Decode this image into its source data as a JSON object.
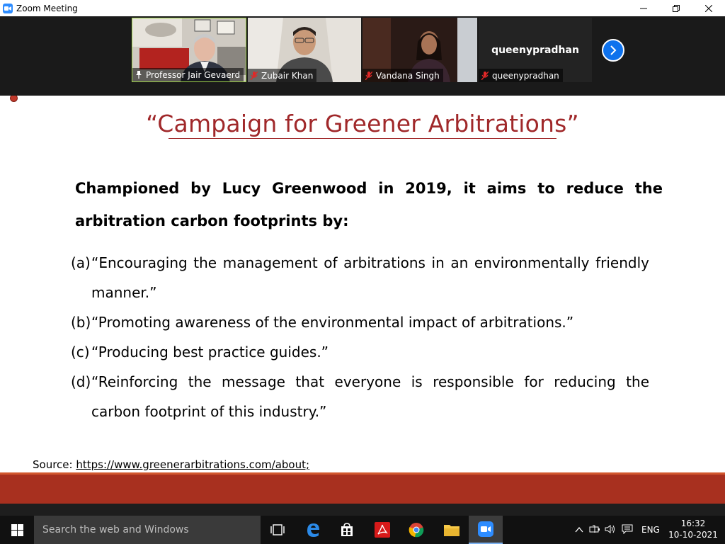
{
  "window": {
    "title": "Zoom Meeting"
  },
  "participants": [
    {
      "name": "Professor Jair Gevaerd"
    },
    {
      "name": "Zubair Khan"
    },
    {
      "name": "Vandana Singh"
    },
    {
      "name": "queenypradhan",
      "display": "queenypradhan"
    }
  ],
  "slide": {
    "title": "“Campaign for Greener Arbitrations”",
    "lead": "Championed by Lucy Greenwood in 2019,  it aims to reduce the arbitration carbon footprints by:",
    "items": [
      {
        "label": "(a)",
        "text": "“Encouraging the management of arbitrations in an environmentally friendly manner.”"
      },
      {
        "label": "(b)",
        "text": "“Promoting awareness of the environmental impact of arbitrations.”"
      },
      {
        "label": "(c)",
        "text": "“Producing best practice guides.”"
      },
      {
        "label": "(d)",
        "text": "“Reinforcing the message that everyone is responsible for reducing the carbon footprint of this industry.”"
      }
    ],
    "source_label": "Source: ",
    "source_link": "https://www.greenerarbitrations.com/about;"
  },
  "taskbar": {
    "search_placeholder": "Search the web and Windows",
    "language": "ENG",
    "time": "16:32",
    "date": "10-10-2021"
  },
  "colors": {
    "title": "#a0282a",
    "band": "#a8301f",
    "zoom_blue": "#2d8cff",
    "active_border": "#9fd34a"
  }
}
